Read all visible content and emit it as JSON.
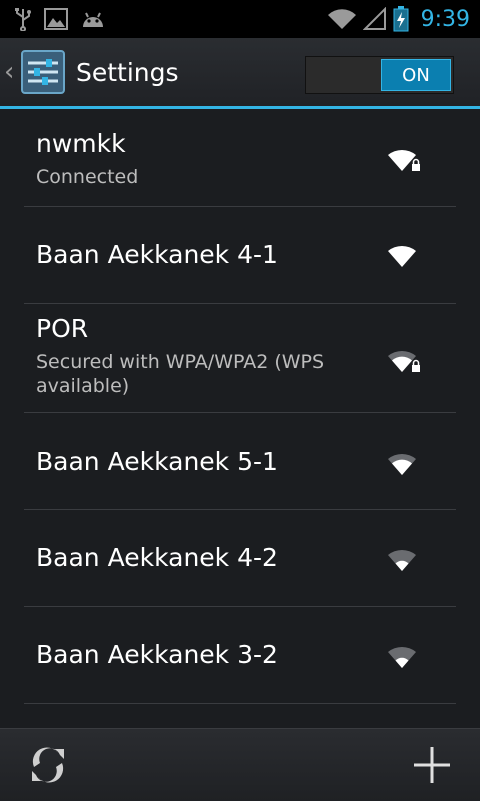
{
  "status_bar": {
    "time": "9:39",
    "icons": [
      "usb-icon",
      "image-icon",
      "android-icon",
      "wifi-icon",
      "cell-signal-icon",
      "battery-icon"
    ],
    "accent_color": "#33b5e5"
  },
  "action_bar": {
    "title": "Settings",
    "toggle_label": "ON",
    "toggle_state": "on"
  },
  "networks": [
    {
      "name": "nwmkk",
      "status": "Connected",
      "secured": true
    },
    {
      "name": "Baan Aekkanek 4-1",
      "status": "",
      "secured": false
    },
    {
      "name": "POR",
      "status": "Secured with WPA/WPA2 (WPS available)",
      "secured": true
    },
    {
      "name": "Baan Aekkanek 5-1",
      "status": "",
      "secured": false
    },
    {
      "name": "Baan Aekkanek 4-2",
      "status": "",
      "secured": false
    },
    {
      "name": "Baan Aekkanek 3-2",
      "status": "",
      "secured": false
    }
  ],
  "bottom_bar": {
    "left_icon": "scan-icon",
    "right_icon": "add-icon"
  }
}
